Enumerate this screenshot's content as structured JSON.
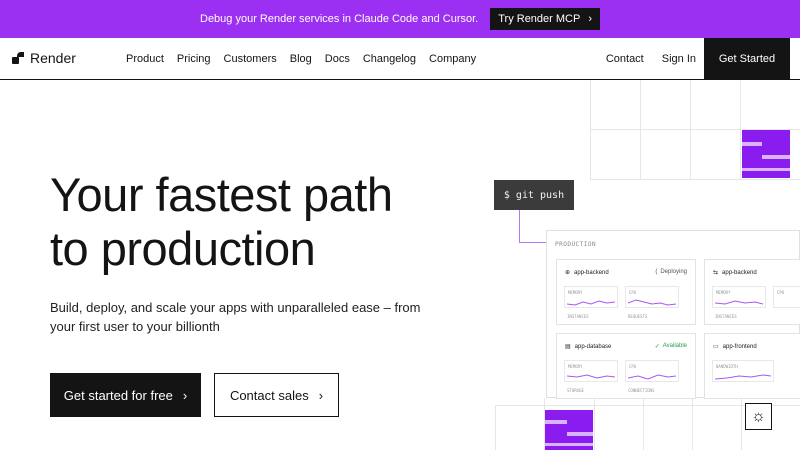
{
  "banner": {
    "text": "Debug your Render services in Claude Code and Cursor.",
    "button": "Try Render MCP",
    "button_icon": "chevron-right-icon",
    "bg_color": "#9b30f2"
  },
  "nav": {
    "logo_text": "Render",
    "items": [
      "Product",
      "Pricing",
      "Customers",
      "Blog",
      "Docs",
      "Changelog",
      "Company"
    ],
    "right_items": [
      "Contact",
      "Sign In"
    ],
    "cta": "Get Started"
  },
  "hero": {
    "title_line1": "Your fastest path",
    "title_line2": "to production",
    "subtitle": "Build, deploy, and scale your apps with unparalleled ease – from your first user to your billionth",
    "primary_btn": "Get started for free",
    "secondary_btn": "Contact sales"
  },
  "illustration": {
    "command": "$ git push",
    "panel_label": "PRODUCTION",
    "services": [
      {
        "name": "app-backend",
        "status": "Deploying",
        "metrics": [
          "MEMORY",
          "CPU"
        ],
        "sub": [
          "INSTANCES",
          "REQUESTS"
        ]
      },
      {
        "name": "app-backend",
        "status": "",
        "metrics": [
          "MEMORY",
          "CPU"
        ],
        "sub": [
          "INSTANCES",
          ""
        ]
      },
      {
        "name": "app-database",
        "status": "Available",
        "metrics": [
          "MEMORY",
          "CPU"
        ],
        "sub": [
          "STORAGE",
          "CONNECTIONS"
        ]
      },
      {
        "name": "app-frontend",
        "status": "",
        "metrics": [
          "BANDWIDTH"
        ],
        "sub": []
      }
    ]
  },
  "colors": {
    "accent": "#8b1cf0",
    "dark": "#141414"
  }
}
